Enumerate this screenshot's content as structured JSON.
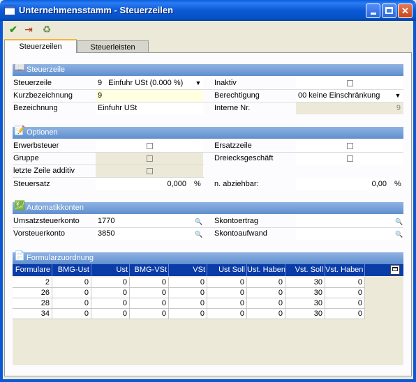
{
  "window": {
    "title": "Unternehmensstamm - Steuerzeilen"
  },
  "toolbar": {
    "icons": [
      "check-icon",
      "exit-icon",
      "trash-icon"
    ]
  },
  "tabs": [
    {
      "label": "Steuerzeilen",
      "active": true
    },
    {
      "label": "Steuerleisten",
      "active": false
    }
  ],
  "steuerzeile": {
    "header": "Steuerzeile",
    "steuerzeile_label": "Steuerzeile",
    "steuerzeile_num": "9",
    "steuerzeile_value": "Einfuhr USt (0.000 %)",
    "inaktiv_label": "Inaktiv",
    "kurz_label": "Kurzbezeichnung",
    "kurz_value": "9",
    "berechtigung_label": "Berechtigung",
    "berechtigung_value": "00 keine Einschränkung",
    "bez_label": "Bezeichnung",
    "bez_value": "Einfuhr USt",
    "interne_label": "Interne Nr.",
    "interne_value": "9"
  },
  "optionen": {
    "header": "Optionen",
    "erwerb_label": "Erwerbsteuer",
    "ersatz_label": "Ersatzzeile",
    "gruppe_label": "Gruppe",
    "dreieck_label": "Dreiecksgeschäft",
    "letzte_label": "letzte Zeile additiv",
    "steuersatz_label": "Steuersatz",
    "steuersatz_value": "0,000",
    "steuersatz_unit": "%",
    "abziehbar_label": "n. abziehbar:",
    "abziehbar_value": "0,00",
    "abziehbar_unit": "%"
  },
  "automatik": {
    "header": "Automatikkonten",
    "umsatz_label": "Umsatzsteuerkonto",
    "umsatz_value": "1770",
    "skontoertrag_label": "Skontoertrag",
    "vorsteuer_label": "Vorsteuerkonto",
    "vorsteuer_value": "3850",
    "skontoaufwand_label": "Skontoaufwand"
  },
  "formular": {
    "header": "Formularzuordnung",
    "columns": [
      "Formulare",
      "BMG-Ust",
      "Ust",
      "BMG-VSt",
      "VSt",
      "Ust Soll",
      "Ust. Haben",
      "Vst. Soll",
      "Vst. Haben"
    ],
    "rows": [
      [
        "2",
        "0",
        "0",
        "0",
        "0",
        "0",
        "0",
        "30",
        "0"
      ],
      [
        "26",
        "0",
        "0",
        "0",
        "0",
        "0",
        "0",
        "30",
        "0"
      ],
      [
        "28",
        "0",
        "0",
        "0",
        "0",
        "0",
        "0",
        "30",
        "0"
      ],
      [
        "34",
        "0",
        "0",
        "0",
        "0",
        "0",
        "0",
        "30",
        "0"
      ]
    ]
  }
}
